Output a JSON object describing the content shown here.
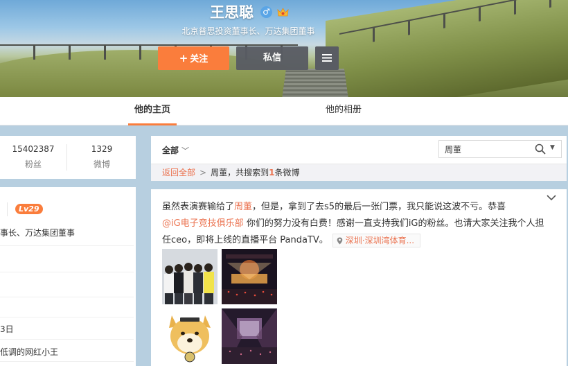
{
  "profile": {
    "name": "王思聪",
    "gender_icon": "male-icon",
    "description": "北京普思投资董事长、万达集团董事"
  },
  "actions": {
    "follow_label": "关注",
    "message_label": "私信",
    "more_icon": "menu-icon"
  },
  "tabs": [
    {
      "label": "他的主页",
      "active": true
    },
    {
      "label": "他的相册",
      "active": false
    }
  ],
  "stats": {
    "fans_count": "15402387",
    "fans_label": "粉丝",
    "posts_count": "1329",
    "posts_label": "微博"
  },
  "sidebar_info": {
    "level": "Lv29",
    "lines": [
      "事长、万达集团董事",
      "",
      "",
      "",
      "3日",
      "低调的网红小王"
    ]
  },
  "search": {
    "filter_label": "全部",
    "query": "周董",
    "back_label": "返回全部",
    "result_prefix": "周董，共搜索到",
    "result_count": "1",
    "result_suffix": "条微博"
  },
  "post": {
    "text_1": "虽然表演赛输给了",
    "highlight_1": "周董",
    "text_2": "，但是，拿到了去s5的最后一张门票，我只能说这波不亏。恭喜",
    "mention": "@iG电子竞技俱乐部",
    "text_3": " 你们的努力没有白费！感谢一直支持我们iG的粉丝。也请大家关注我个人担任ceo，即将上线的直播平台 PandaTV。",
    "location": "深圳·深圳湾体育..."
  },
  "colors": {
    "accent": "#fa7d3c",
    "link": "#eb7350",
    "dark_button": "#595c63",
    "page_bg": "#b7cfe0"
  }
}
